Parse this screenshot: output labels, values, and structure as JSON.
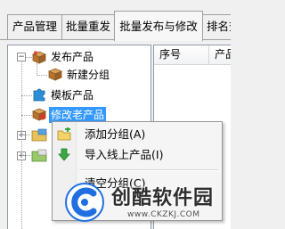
{
  "tabs": [
    {
      "label": "产品管理",
      "active": false
    },
    {
      "label": "批量重发",
      "active": false
    },
    {
      "label": "批量发布与修改",
      "active": true
    },
    {
      "label": "排名查",
      "active": false
    }
  ],
  "tree": {
    "items": [
      {
        "label": "发布产品",
        "icon": "box-icon"
      },
      {
        "label": "新建分组",
        "icon": "box-icon"
      },
      {
        "label": "模板产品",
        "icon": "puzzle-icon"
      },
      {
        "label": "修改老产品",
        "icon": "box-edit-icon",
        "selected": true
      }
    ]
  },
  "grid": {
    "columns": [
      "序号",
      "产品"
    ]
  },
  "context_menu": {
    "items": [
      {
        "label": "添加分组(A)",
        "icon": "add-folder-icon"
      },
      {
        "label": "导入线上产品(I)",
        "icon": "download-arrow-icon"
      },
      {
        "label": "清空分组(C)",
        "icon": ""
      }
    ]
  },
  "watermark": {
    "title": "创酷软件园",
    "url": "www.CKZKJ.COM"
  },
  "colors": {
    "selection": "#3399ff",
    "watermark_blue": "#1f6fe0"
  }
}
